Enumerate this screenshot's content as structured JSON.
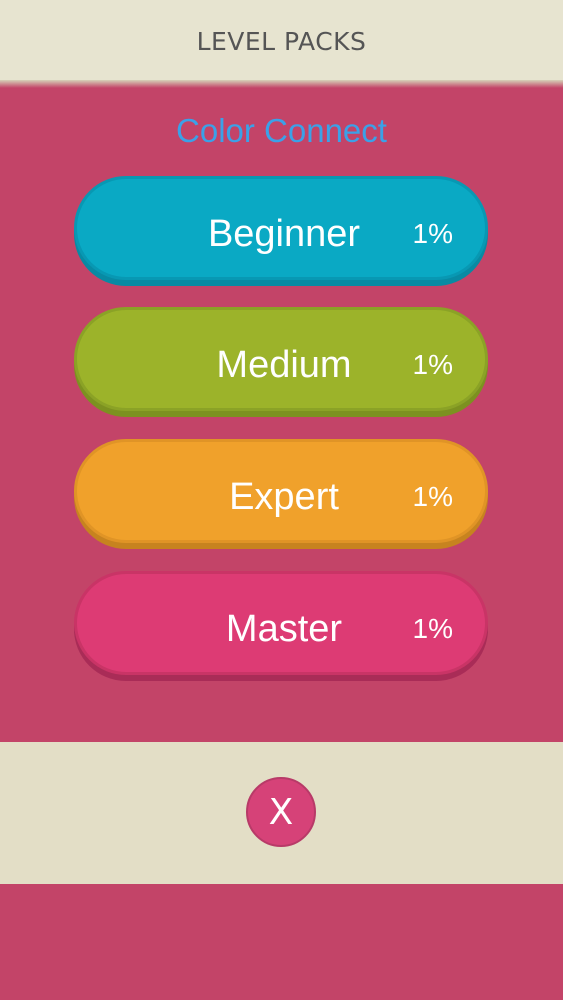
{
  "header": {
    "title": "LEVEL PACKS"
  },
  "game_title": "Color Connect",
  "packs": [
    {
      "label": "Beginner",
      "progress": "1%",
      "color": "#0aa9c4",
      "shadow": "#088aa3",
      "border": "#0898b3"
    },
    {
      "label": "Medium",
      "progress": "1%",
      "color": "#9cb32a",
      "shadow": "#7c9120",
      "border": "#8ba226"
    },
    {
      "label": "Expert",
      "progress": "1%",
      "color": "#f0a12b",
      "shadow": "#c7831f",
      "border": "#e09426"
    },
    {
      "label": "Master",
      "progress": "1%",
      "color": "#dd3b74",
      "shadow": "#a92c57",
      "border": "#c93466"
    }
  ],
  "footer": {
    "close_label": "X"
  },
  "colors": {
    "background": "#c34468",
    "header_bg": "#e7e4d0",
    "title_accent": "#3ba1e8"
  }
}
